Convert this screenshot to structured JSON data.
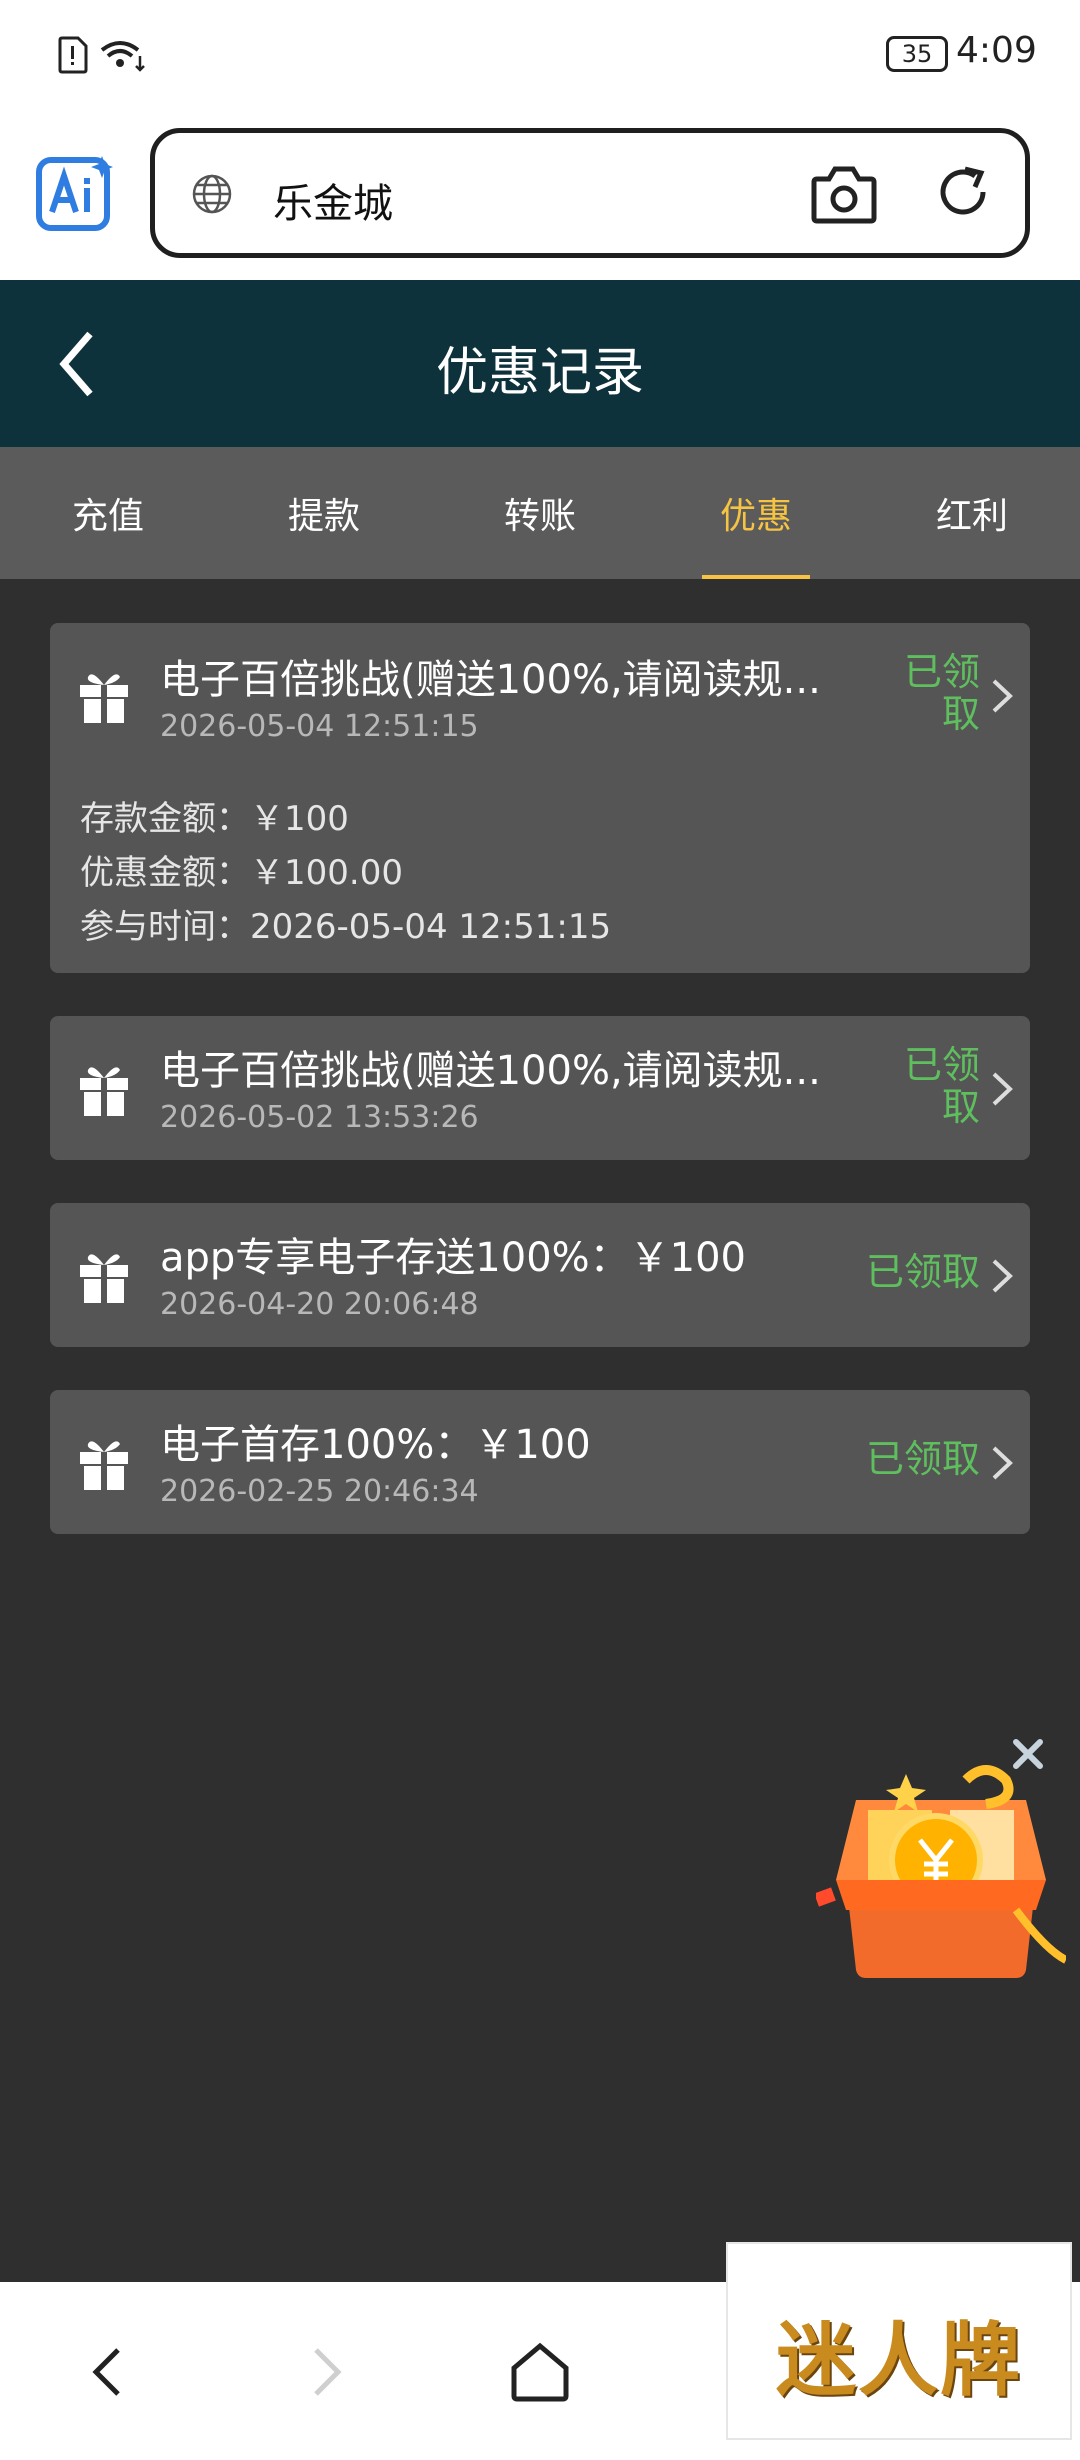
{
  "status_bar": {
    "battery": "35",
    "time": "4:09"
  },
  "browser": {
    "url_text": "乐金城"
  },
  "header": {
    "title": "优惠记录"
  },
  "tabs": [
    {
      "label": "充值"
    },
    {
      "label": "提款"
    },
    {
      "label": "转账"
    },
    {
      "label": "优惠",
      "active": true
    },
    {
      "label": "红利"
    }
  ],
  "records": [
    {
      "title": "电子百倍挑战(赠送100%,请阅读规...",
      "date": "2026-05-04 12:51:15",
      "status_line1": "已领",
      "status_line2": "取",
      "details": [
        "存款金额：￥100",
        "优惠金额：￥100.00",
        "参与时间：2026-05-04 12:51:15"
      ]
    },
    {
      "title": "电子百倍挑战(赠送100%,请阅读规...",
      "date": "2026-05-02 13:53:26",
      "status_line1": "已领",
      "status_line2": "取"
    },
    {
      "title": "app专享电子存送100%：￥100",
      "date": "2026-04-20 20:06:48",
      "status": "已领取"
    },
    {
      "title": "电子首存100%：￥100",
      "date": "2026-02-25 20:46:34",
      "status": "已领取"
    }
  ],
  "watermark": {
    "text": "迷人牌"
  },
  "colors": {
    "header_bg": "#0d323c",
    "tab_active": "#f6c342",
    "status_green": "#5fbf5f",
    "card_bg": "#555555"
  }
}
